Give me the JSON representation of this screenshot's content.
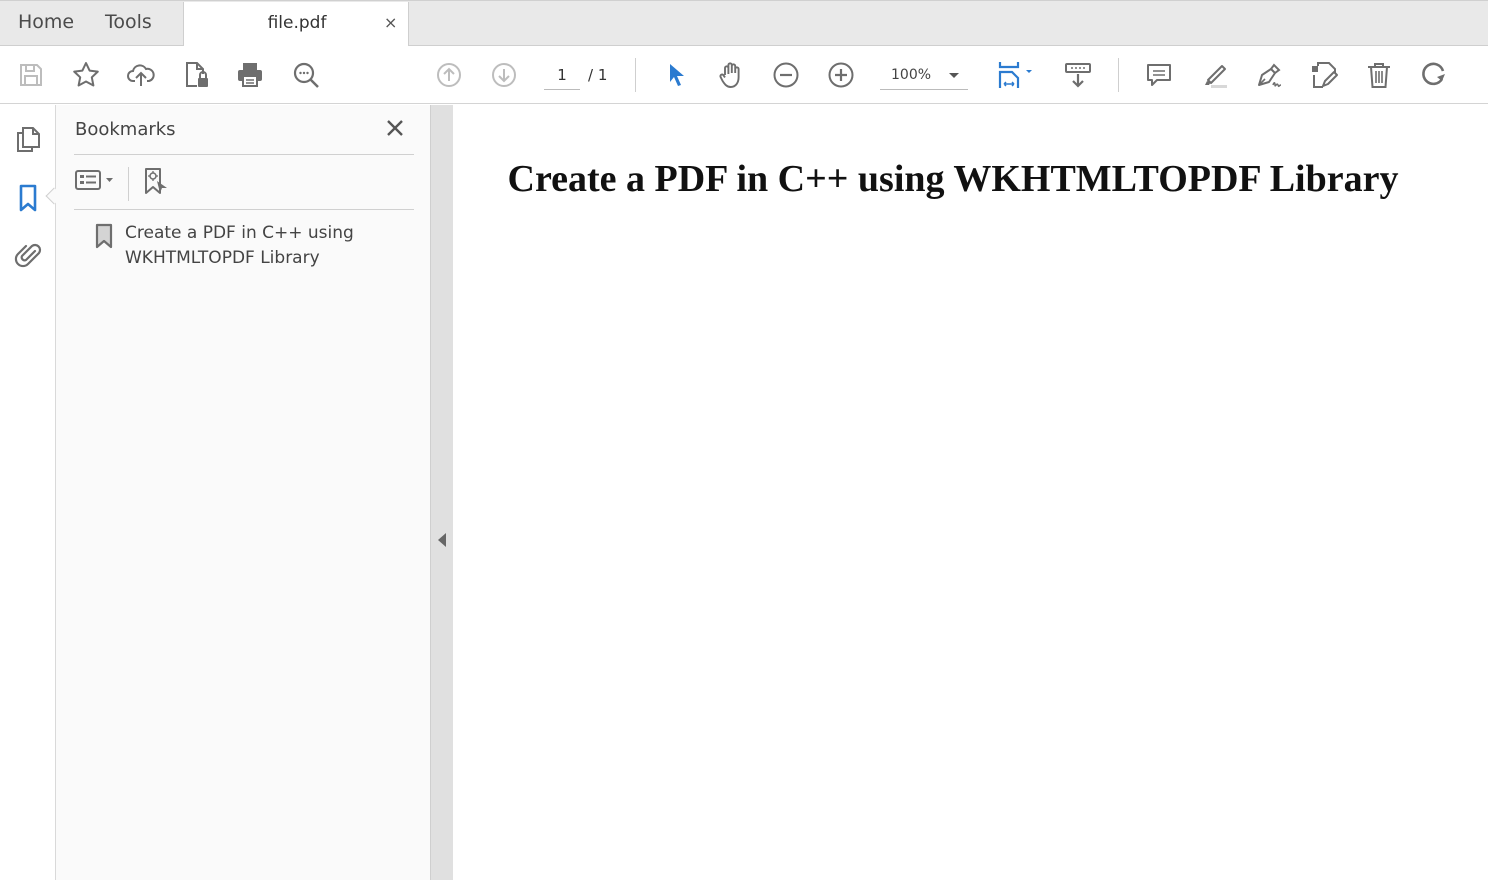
{
  "tabs": {
    "home": "Home",
    "tools": "Tools",
    "document": "file.pdf",
    "close_glyph": "×"
  },
  "toolbar": {
    "icons": [
      "save-icon",
      "bookmark-star-icon",
      "upload-cloud-icon",
      "protect-file-icon",
      "print-icon",
      "find-icon",
      "page-up-icon",
      "page-down-icon",
      "select-tool-icon",
      "hand-tool-icon",
      "zoom-out-icon",
      "zoom-in-icon",
      "fit-page-icon",
      "scroll-mode-icon",
      "comment-icon",
      "highlight-icon",
      "sign-icon",
      "edit-pdf-icon",
      "delete-icon",
      "rotate-icon"
    ],
    "current_page": "1",
    "page_total": "/ 1",
    "zoom_level": "100%"
  },
  "colors": {
    "accent": "#2b7bd0",
    "icon": "#6e6e6e",
    "icon_disabled": "#bdbdbd"
  },
  "sidebar": {
    "rail": [
      "page-thumbnails-icon",
      "bookmarks-icon",
      "attachments-icon"
    ],
    "panel_title": "Bookmarks",
    "bookmarks": [
      {
        "label": "Create a PDF in C++ using WKHTMLTOPDF Library"
      }
    ]
  },
  "document": {
    "heading": "Create a PDF in C++ using WKHTMLTOPDF Library"
  }
}
